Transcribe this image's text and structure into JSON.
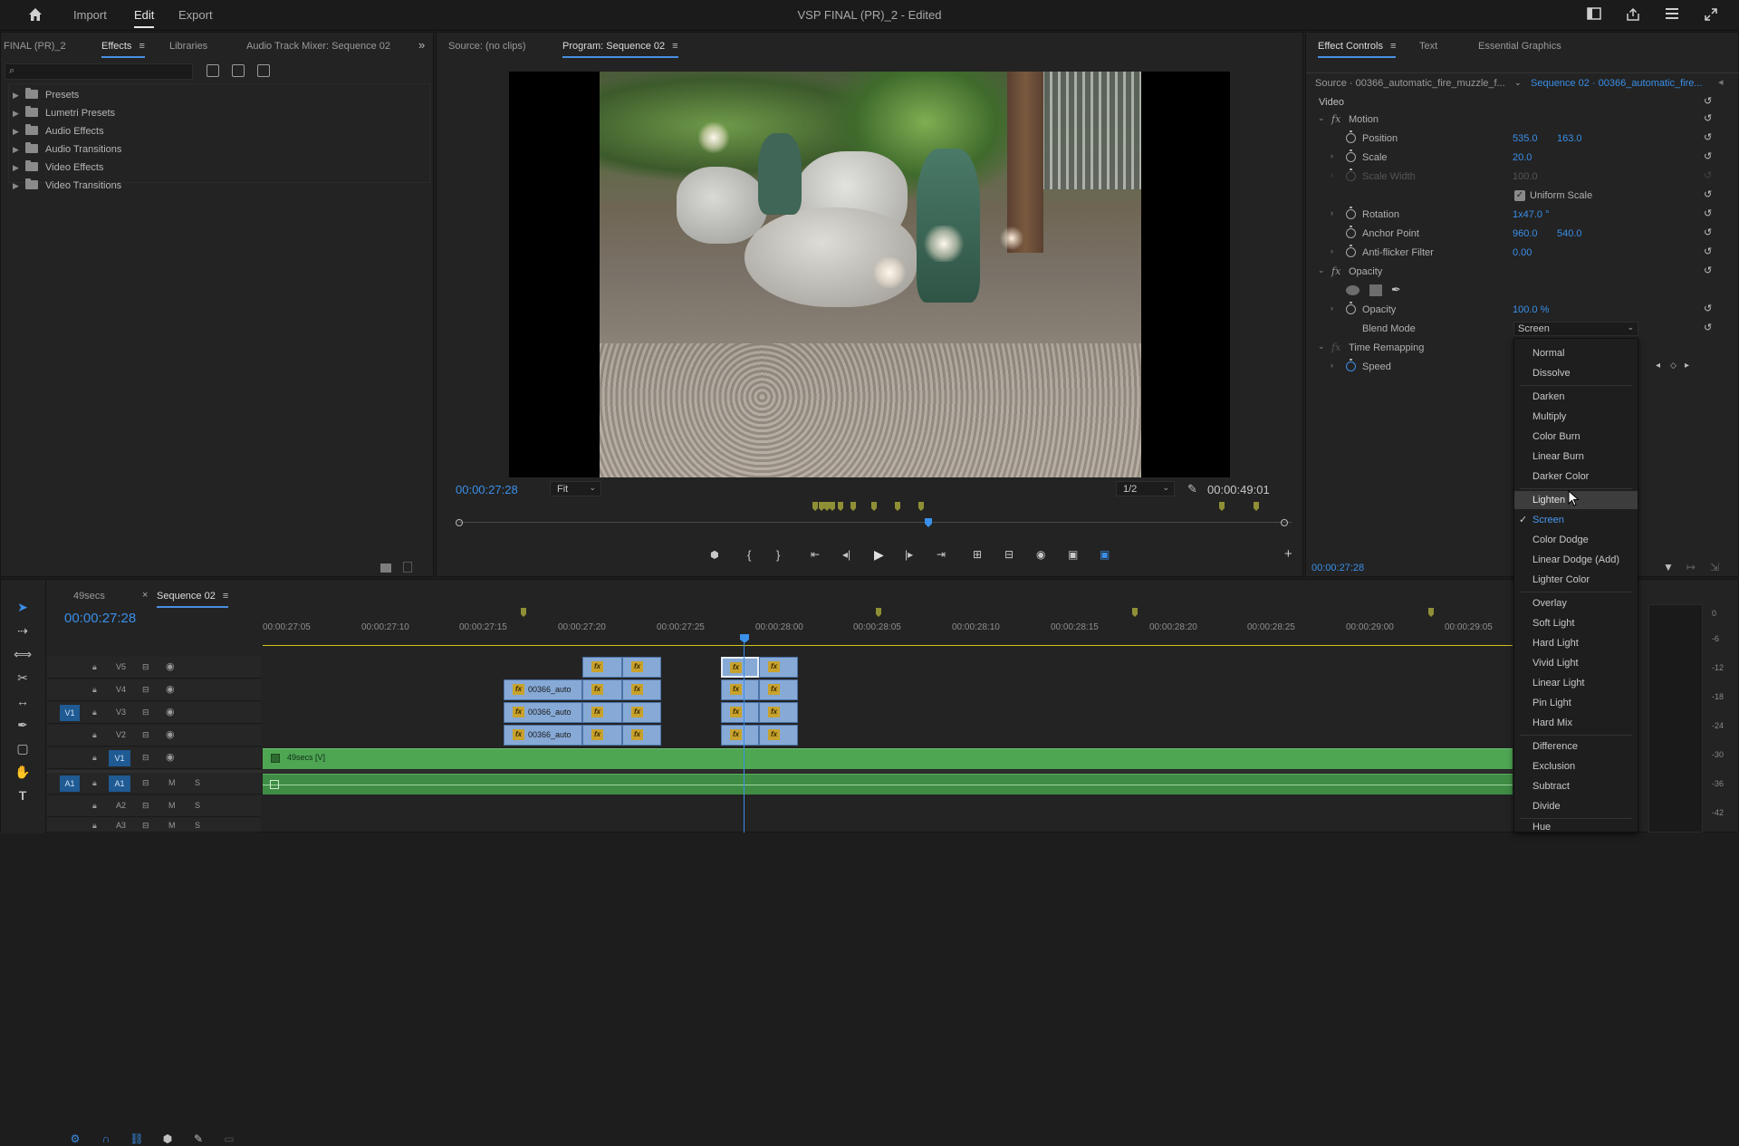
{
  "topbar": {
    "nav": [
      "Import",
      "Edit",
      "Export"
    ],
    "title": "VSP FINAL (PR)_2",
    "edited": " - Edited"
  },
  "effects_panel": {
    "project_tab": "FINAL (PR)_2",
    "tabs": [
      "Effects",
      "Libraries",
      "Audio Track Mixer: Sequence 02"
    ],
    "search_placeholder": "",
    "tree": [
      "Presets",
      "Lumetri Presets",
      "Audio Effects",
      "Audio Transitions",
      "Video Effects",
      "Video Transitions"
    ]
  },
  "program_monitor": {
    "tabs": [
      "Source: (no clips)",
      "Program: Sequence 02"
    ],
    "timecode": "00:00:27:28",
    "fit": "Fit",
    "resolution": "1/2",
    "duration": "00:00:49:01"
  },
  "effect_controls": {
    "tabs": [
      "Effect Controls",
      "Text",
      "Essential Graphics"
    ],
    "source": "Source · 00366_automatic_fire_muzzle_f...",
    "sequence": "Sequence 02 · 00366_automatic_fire...",
    "section": "Video",
    "motion": "Motion",
    "position_label": "Position",
    "position_x": "535.0",
    "position_y": "163.0",
    "scale_label": "Scale",
    "scale": "20.0",
    "scale_width_label": "Scale Width",
    "scale_width": "100.0",
    "uniform_scale": "Uniform Scale",
    "rotation_label": "Rotation",
    "rotation": "1x47.0 °",
    "anchor_label": "Anchor Point",
    "anchor_x": "960.0",
    "anchor_y": "540.0",
    "antiflicker_label": "Anti-flicker Filter",
    "antiflicker": "0.00",
    "opacity_section": "Opacity",
    "opacity_label": "Opacity",
    "opacity": "100.0 %",
    "blend_label": "Blend Mode",
    "blend_value": "Screen",
    "time_remap": "Time Remapping",
    "speed_label": "Speed",
    "timecode": "00:00:27:28"
  },
  "blend_options": [
    "Normal",
    "Dissolve",
    "Darken",
    "Multiply",
    "Color Burn",
    "Linear Burn",
    "Darker Color",
    "Lighten",
    "Screen",
    "Color Dodge",
    "Linear Dodge (Add)",
    "Lighter Color",
    "Overlay",
    "Soft Light",
    "Hard Light",
    "Vivid Light",
    "Linear Light",
    "Pin Light",
    "Hard Mix",
    "Difference",
    "Exclusion",
    "Subtract",
    "Divide",
    "Hue"
  ],
  "timeline": {
    "tabs": [
      "49secs",
      "Sequence 02"
    ],
    "timecode": "00:00:27:28",
    "ruler": [
      "00:00:27:05",
      "00:00:27:10",
      "00:00:27:15",
      "00:00:27:20",
      "00:00:27:25",
      "00:00:28:00",
      "00:00:28:05",
      "00:00:28:10",
      "00:00:28:15",
      "00:00:28:20",
      "00:00:28:25",
      "00:00:29:00",
      "00:00:29:05"
    ],
    "tracks": [
      "V5",
      "V4",
      "V3",
      "V2",
      "V1",
      "A1",
      "A2",
      "A3"
    ],
    "v1_target": "V1",
    "a1_target": "A1",
    "clip_name": "00366_auto",
    "fx": "fx",
    "main_clip": "49secs [V]",
    "mute": "M",
    "solo": "S"
  },
  "meter_labels": [
    "0",
    "-6",
    "-12",
    "-18",
    "-24",
    "-30",
    "-36",
    "-42"
  ],
  "colors": {
    "accent": "#3a8fe8",
    "clip_blue": "#86a9d6",
    "clip_green": "#4ea552",
    "fx_badge": "#c8a22c",
    "playhead": "#3a8fe8"
  }
}
